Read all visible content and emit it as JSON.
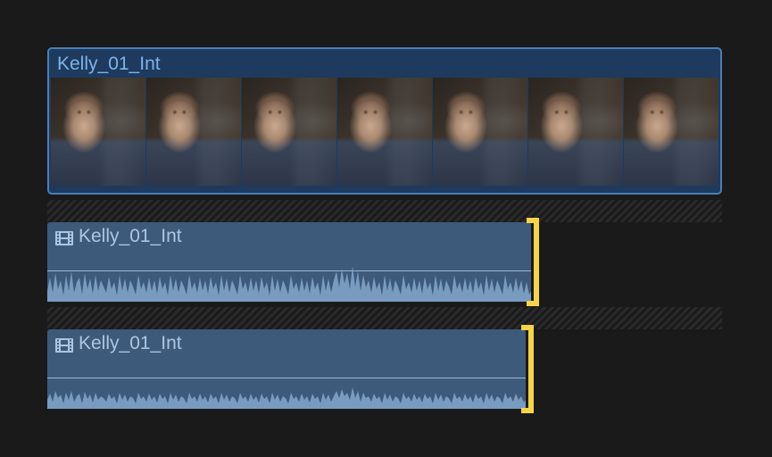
{
  "video_clip": {
    "name": "Kelly_01_Int"
  },
  "audio_clips": [
    {
      "name": "Kelly_01_Int"
    },
    {
      "name": "Kelly_01_Int"
    }
  ],
  "colors": {
    "clip_bg": "#3d5a7a",
    "clip_border": "#4a7fb5",
    "text": "#aac6e3",
    "edit_marker": "#f5d547",
    "waveform": "#7a9bc0"
  }
}
